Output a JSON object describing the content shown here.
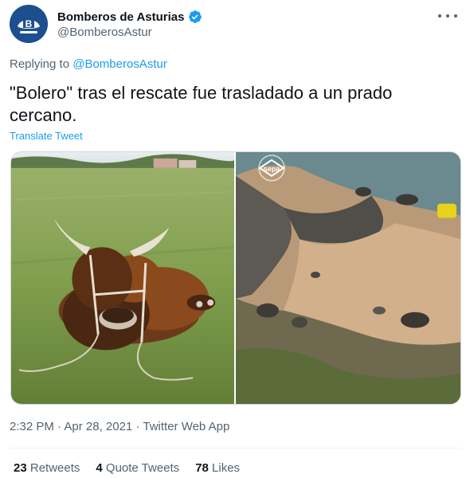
{
  "header": {
    "display_name": "Bomberos de Asturias",
    "handle": "@BomberosAstur",
    "avatar_icon": "bomberos-logo",
    "verified_icon": "verified-badge-icon",
    "more_icon": "more-options-icon"
  },
  "reply": {
    "prefix": "Replying to ",
    "to_handle": "@BomberosAstur"
  },
  "tweet": {
    "text": "\"Bolero\" tras el rescate fue trasladado a un prado cercano.",
    "translate_label": "Translate Tweet"
  },
  "media": {
    "photos": [
      {
        "description_icon": "bull-in-meadow-photo"
      },
      {
        "description_icon": "rocky-beach-photo",
        "watermark": "sepa"
      }
    ]
  },
  "meta": {
    "time": "2:32 PM",
    "separator": " · ",
    "date": "Apr 28, 2021",
    "app": "Twitter Web App"
  },
  "stats": {
    "retweets_count": "23",
    "retweets_label": " Retweets",
    "quotes_count": "4",
    "quotes_label": " Quote Tweets",
    "likes_count": "78",
    "likes_label": " Likes"
  },
  "colors": {
    "link": "#1d9bf0",
    "secondary_text": "#536471",
    "primary_text": "#0f1419",
    "avatar_bg": "#1d4f8f"
  }
}
